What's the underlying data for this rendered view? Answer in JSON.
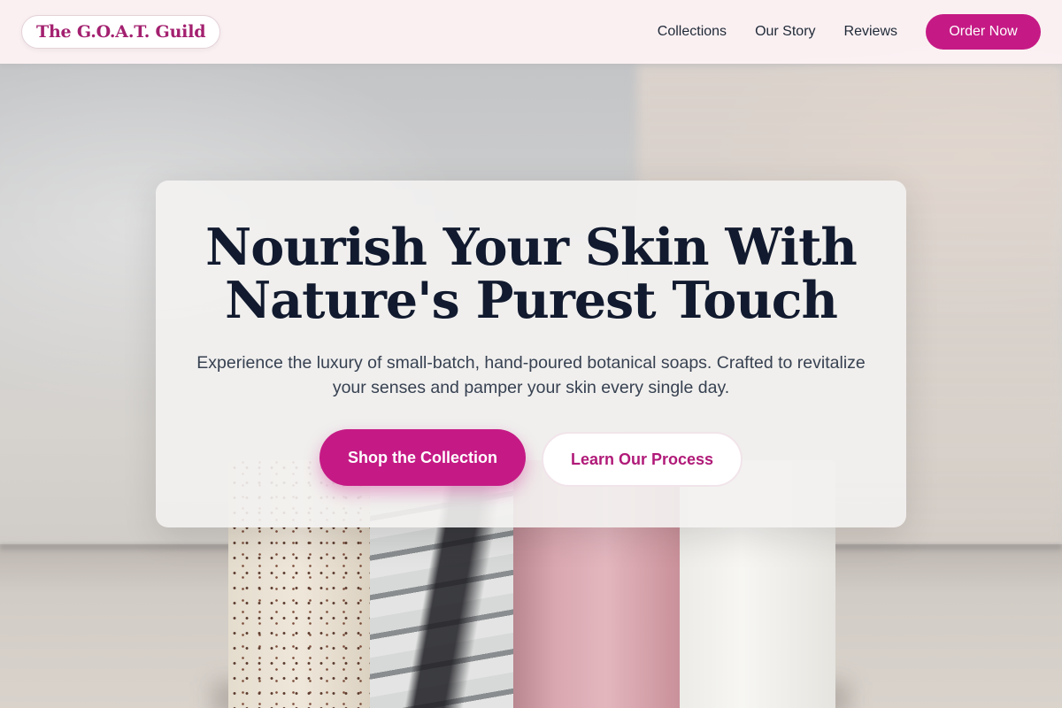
{
  "header": {
    "logo_text": "The G.O.A.T. Guild",
    "nav": [
      {
        "label": "Collections"
      },
      {
        "label": "Our Story"
      },
      {
        "label": "Reviews"
      }
    ],
    "cta_label": "Order Now"
  },
  "hero": {
    "title_line1": "Nourish Your Skin With",
    "title_line2": "Nature's Purest Touch",
    "subtitle": "Experience the luxury of small-batch, hand-poured botanical soaps. Crafted to revitalize your senses and pamper your skin every single day.",
    "primary_button": "Shop the Collection",
    "secondary_button": "Learn Our Process"
  },
  "colors": {
    "accent": "#c51a85",
    "header_bg": "#fdf2f4",
    "title": "#111a2e"
  }
}
